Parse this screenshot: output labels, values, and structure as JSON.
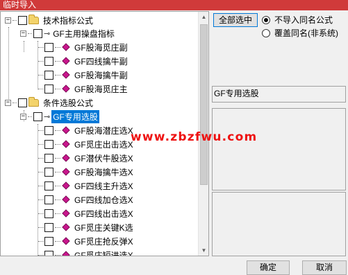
{
  "window": {
    "title": "临时导入"
  },
  "tree": {
    "nodes": [
      {
        "label": "技术指标公式",
        "kind": "folder"
      },
      {
        "label": "GF主用操盘指标",
        "kind": "key"
      },
      {
        "label": "GF股海觅庄副",
        "kind": "formula"
      },
      {
        "label": "GF四线擒牛副",
        "kind": "formula"
      },
      {
        "label": "GF股海擒牛副",
        "kind": "formula"
      },
      {
        "label": "GF股海觅庄主",
        "kind": "formula"
      },
      {
        "label": "条件选股公式",
        "kind": "folder"
      },
      {
        "label": "GF专用选股",
        "kind": "key",
        "selected": true
      },
      {
        "label": "GF股海潜庄选X",
        "kind": "formula"
      },
      {
        "label": "GF觅庄出击选X",
        "kind": "formula"
      },
      {
        "label": "GF潜伏牛股选X",
        "kind": "formula"
      },
      {
        "label": "GF股海擒牛选X",
        "kind": "formula"
      },
      {
        "label": "GF四线主升选X",
        "kind": "formula"
      },
      {
        "label": "GF四线加仓选X",
        "kind": "formula"
      },
      {
        "label": "GF四线出击选X",
        "kind": "formula"
      },
      {
        "label": "GF觅庄关键K选",
        "kind": "formula"
      },
      {
        "label": "GF觅庄抢反弹X",
        "kind": "formula"
      },
      {
        "label": "GF觅庄短进选X",
        "kind": "formula"
      }
    ]
  },
  "right": {
    "select_all_label": "全部选中",
    "radio_options": [
      {
        "label": "不导入同名公式",
        "checked": true
      },
      {
        "label": "覆盖同名(非系统)",
        "checked": false
      }
    ],
    "selected_name": "GF专用选股"
  },
  "watermark": "www.zbzfwu.com",
  "buttons": {
    "ok": "确定",
    "cancel": "取消"
  },
  "icons": {
    "expander": "minus-box-icon",
    "folder": "folder-icon",
    "key": "key-icon",
    "formula": "diamond-formula-icon",
    "scroll_up": "scroll-up-arrow-icon",
    "scroll_down": "scroll-down-arrow-icon"
  },
  "colors": {
    "title_bar": "#d03a3a",
    "selection": "#0078d7",
    "formula_icon": "#c8168c",
    "watermark": "#ee1111"
  }
}
